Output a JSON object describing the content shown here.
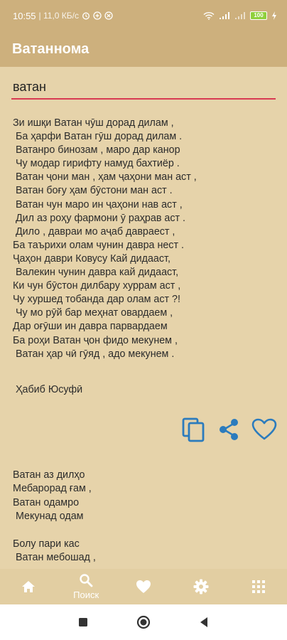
{
  "status_bar": {
    "time": "10:55",
    "speed": "| 11,0 КБ/с",
    "battery": "100"
  },
  "app_bar": {
    "title": "Ватаннома"
  },
  "search": {
    "value": "ватан",
    "placeholder": ""
  },
  "poem": {
    "lines": [
      "Зи ишқи Ватан чӯш дорад дилам ,",
      " Ба ҳарфи Ватан гӯш дорад дилам .",
      " Ватанро бинозам , маро дар канор",
      " Чу модар гирифту намуд бахтиёр .",
      " Ватан ҷони ман , ҳам ҷаҳони ман аст ,",
      " Ватан боғу ҳам бӯстони ман аст .",
      " Ватан чун маро ин ҷаҳони нав аст ,",
      " Дил аз роҳу фармони ӯ раҳрав аст .",
      " Дило , давраи мо аҷаб давраест ,",
      "Ба таърихи олам чунин давра нест .",
      "Ҷаҳон даври Ковусу Кай дидааст,",
      " Валекин чунин давра кай дидааст,",
      "Ки чун бӯстон дилбару хуррам аст ,",
      "Чу хуршед тобанда дар олам аст ?!",
      " Чу мо рӯй бар меҳнат овардаем ,",
      "Дар оғӯши ин давра парвардаем",
      "Ба роҳи Ватан ҷон фидо мекунем ,",
      " Ватан ҳар чӣ гӯяд , адо мекунем ."
    ],
    "author": "Ҳабиб Юсуфӣ"
  },
  "poem_next": {
    "lines": [
      "Ватан аз дилҳо",
      "Мебарорад ғам ,",
      "Ватан одамро",
      " Мекунад одам",
      "",
      "Болу пари кас",
      " Ватан мебошад ,"
    ]
  },
  "actions": {
    "copy_icon": "copy-icon",
    "share_icon": "share-icon",
    "favorite_icon": "heart-outline-icon"
  },
  "nav": {
    "items": [
      {
        "icon": "home-icon",
        "label": ""
      },
      {
        "icon": "search-icon",
        "label": "Поиск"
      },
      {
        "icon": "heart-icon",
        "label": ""
      },
      {
        "icon": "gear-icon",
        "label": ""
      },
      {
        "icon": "grid-icon",
        "label": ""
      }
    ]
  },
  "colors": {
    "app_bar": "#cdb07d",
    "background": "#e6d3aa",
    "accent": "#2b7bbd",
    "search_underline": "#d83a52"
  }
}
